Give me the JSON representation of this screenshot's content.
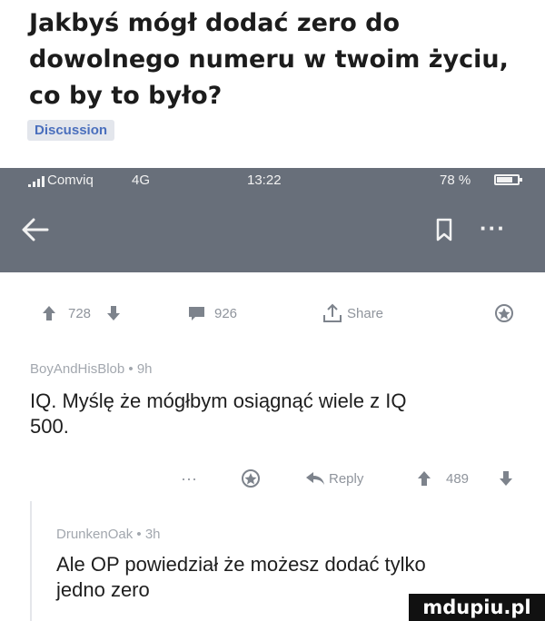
{
  "post": {
    "title": "Jakbyś mógł dodać zero do dowolnego numeru w twoim życiu, co by to było?",
    "flair": "Discussion"
  },
  "status_bar": {
    "carrier": "Comviq",
    "network": "4G",
    "time": "13:22",
    "battery": "78 %",
    "battery_level": 0.78
  },
  "nav": {
    "icons": [
      "back-arrow-icon",
      "bookmark-icon",
      "more-icon"
    ],
    "more_label": "···"
  },
  "actions": {
    "upvotes": "728",
    "comments": "926",
    "share_label": "Share"
  },
  "comments": [
    {
      "author": "BoyAndHisBlob",
      "age": "9h",
      "text": "IQ. Myślę że mógłbym osiągnąć wiele z IQ 500.",
      "more": "···",
      "reply_label": "Reply",
      "votes": "489"
    },
    {
      "author": "DrunkenOak",
      "age": "3h",
      "text": "Ale OP powiedział że możesz dodać tylko jedno zero"
    }
  ],
  "watermark": "mdupiu.pl",
  "colors": {
    "status_bar": "#686f7a",
    "flair_text": "#4a6fbd",
    "meta_text": "#8f949c"
  }
}
